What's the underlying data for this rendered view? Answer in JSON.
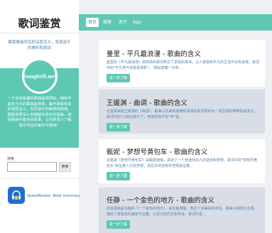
{
  "sidebar": {
    "site_title": "歌词鉴赏",
    "tagline": "解锁歌曲背后的深层含义，发现音乐的美妙和感动",
    "logo_text": "Songtell.net",
    "about": "一个专有有趣的歌曲鉴赏网站，拥有丰富多元化的歌曲鉴赏库。解开歌曲背后的深层含义，发现音乐的美感和情感。帮助你更深入地理解你喜欢的歌曲，感受歌曲中蕴含的故事，让你更深入了解音乐作品的美妙与感动！",
    "search": {
      "label": "搜索",
      "placeholder": "",
      "button": "搜索"
    },
    "app": {
      "icon": "headphones-book-icon",
      "label": "SpeedReader: Book Summary"
    }
  },
  "nav": {
    "items": [
      {
        "label": "首页",
        "active": true
      },
      {
        "label": "搜索",
        "active": false
      },
      {
        "label": "关于",
        "active": false
      },
      {
        "label": "App",
        "active": false
      }
    ]
  },
  "cards": [
    {
      "title": "曼里 - 平凡最浪漫 - 歌曲的含义",
      "excerpt": "曼里的《平凡最浪漫》用简单的歌词表达了爱情的真谛，让人感受到平凡的生活中也有浪漫。歌词中的\"平凡地与你看看电影\"，\"彼此牵着一切变...",
      "button": "进一步了解"
    },
    {
      "title": "王媛渊 - 曲调 - 歌曲的含义",
      "excerpt": "这首歌曲是王媛渊的《曲调》，歌曲以优美的旋律和深情的歌词表现出一段恋情的种种情绪变化。歌词中的\"心跳在跳不了，到底现有不好\"听\"说...",
      "button": "进一步了解"
    },
    {
      "title": "甄妮 - 梦想号黄包车 - 歌曲的含义",
      "excerpt": "这首歌《梦想号黄包车》由甄妮演唱，讲述了一个普通劳动人的坚持和梦想。歌词中的\"梦想号黄包车\"象征着人们的梦想，而拉车的苦和辛苦则象征着...",
      "button": "进一步了解"
    },
    {
      "title": "任静 - 一个金色的地方 - 歌曲的含义",
      "excerpt": "这首歌曲是任静的《一个金色的地方》，由任静演唱，表达了对美好的向往。歌曲以明亮为主题，描绘了那金色的美丽与宝藏，以及它的历史和传说。歌词中说...",
      "button": "进一步了解"
    }
  ]
}
